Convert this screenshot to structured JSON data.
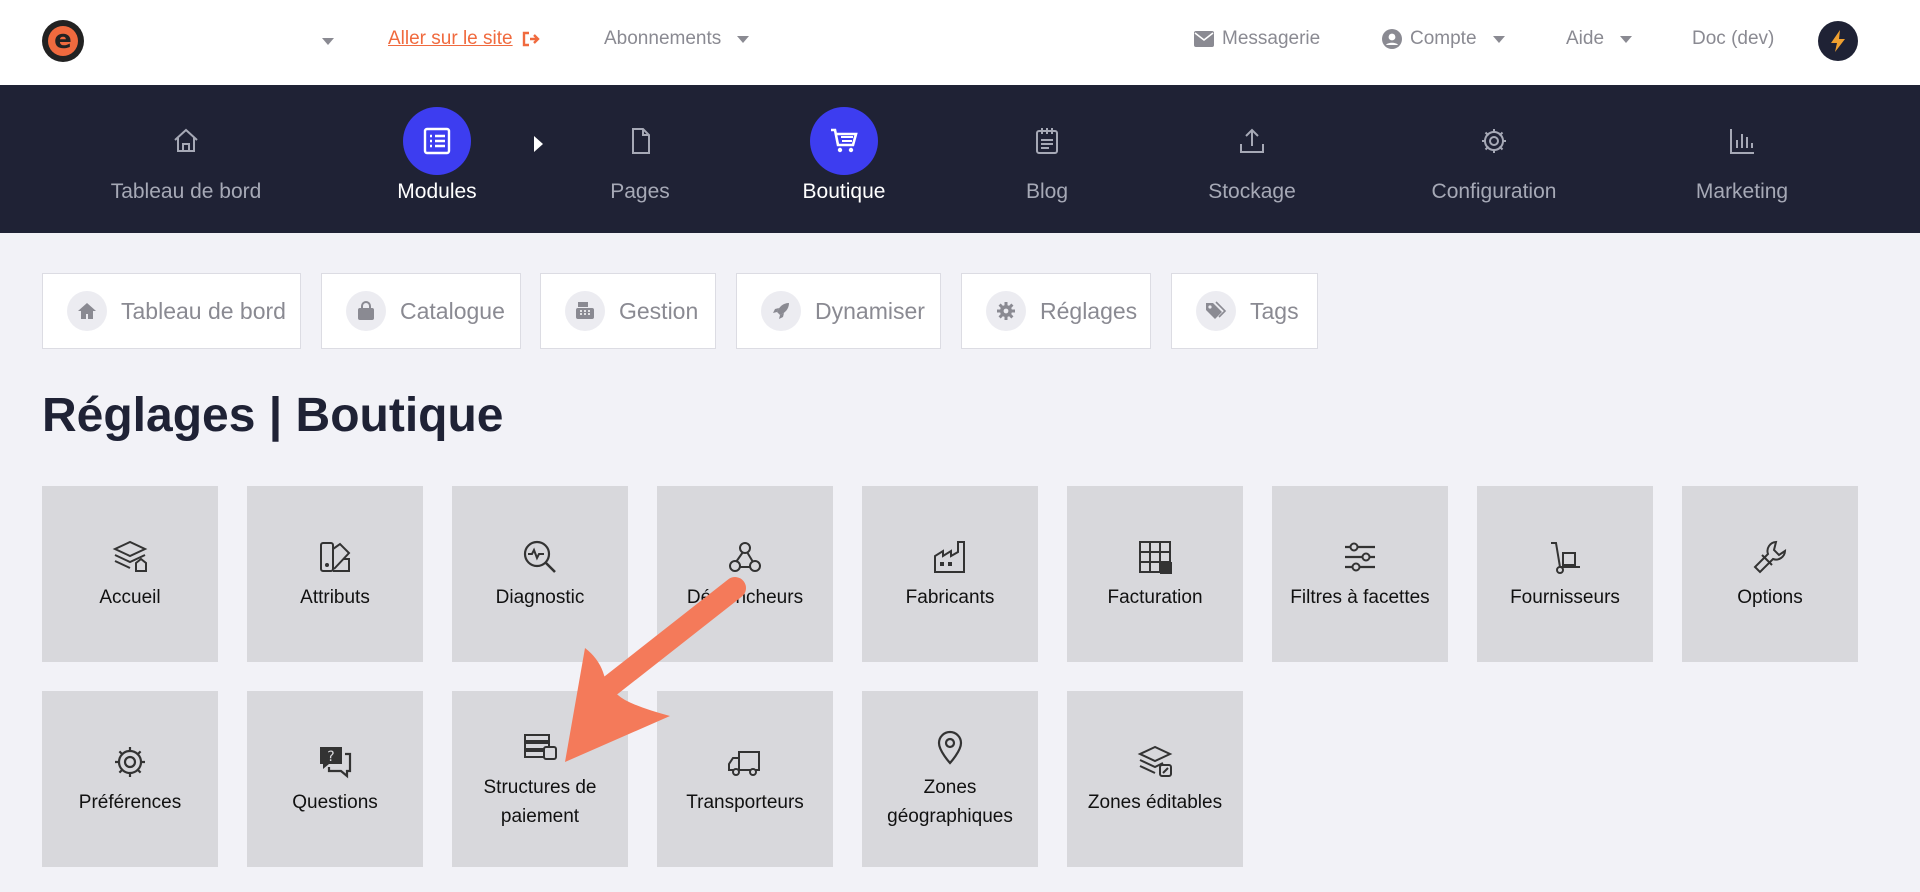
{
  "topbar": {
    "logo_letter": "e",
    "site_link": "Aller sur le site",
    "subscriptions": "Abonnements",
    "messages": "Messagerie",
    "account": "Compte",
    "help": "Aide",
    "doc": "Doc (dev)"
  },
  "nav": {
    "items": [
      {
        "label": "Tableau de bord",
        "icon": "home-icon",
        "active": false
      },
      {
        "label": "Modules",
        "icon": "list-icon",
        "active": true
      },
      {
        "label": "Pages",
        "icon": "file-icon",
        "active": false
      },
      {
        "label": "Boutique",
        "icon": "cart-icon",
        "active": true
      },
      {
        "label": "Blog",
        "icon": "notepad-icon",
        "active": false
      },
      {
        "label": "Stockage",
        "icon": "upload-icon",
        "active": false
      },
      {
        "label": "Configuration",
        "icon": "gear-icon",
        "active": false
      },
      {
        "label": "Marketing",
        "icon": "bar-chart-icon",
        "active": false
      }
    ]
  },
  "subtabs": [
    {
      "label": "Tableau de bord",
      "icon": "home-icon"
    },
    {
      "label": "Catalogue",
      "icon": "bag-icon"
    },
    {
      "label": "Gestion",
      "icon": "register-icon"
    },
    {
      "label": "Dynamiser",
      "icon": "rocket-icon"
    },
    {
      "label": "Réglages",
      "icon": "gear-icon"
    },
    {
      "label": "Tags",
      "icon": "tags-icon"
    }
  ],
  "page_title": "Réglages | Boutique",
  "tiles": [
    {
      "label": "Accueil",
      "icon": "layers-home-icon"
    },
    {
      "label": "Attributs",
      "icon": "swatch-icon"
    },
    {
      "label": "Diagnostic",
      "icon": "search-pulse-icon"
    },
    {
      "label": "Déclencheurs",
      "icon": "webhook-icon"
    },
    {
      "label": "Fabricants",
      "icon": "factory-icon"
    },
    {
      "label": "Facturation",
      "icon": "grid-invoice-icon"
    },
    {
      "label": "Filtres à facettes",
      "icon": "sliders-icon"
    },
    {
      "label": "Fournisseurs",
      "icon": "dolly-icon"
    },
    {
      "label": "Options",
      "icon": "wrench-icon"
    },
    {
      "label": "Préférences",
      "icon": "gear-icon"
    },
    {
      "label": "Questions",
      "icon": "question-chat-icon"
    },
    {
      "label": "Structures de paiement",
      "icon": "cash-stack-icon"
    },
    {
      "label": "Transporteurs",
      "icon": "truck-icon"
    },
    {
      "label": "Zones géographiques",
      "icon": "map-pin-icon"
    },
    {
      "label": "Zones éditables",
      "icon": "layers-edit-icon"
    }
  ],
  "colors": {
    "accent": "#3d3df0",
    "nav_bg": "#1f2235",
    "link": "#f06a3e",
    "annotation_arrow": "#f47a5a",
    "tile_bg": "#d8d8dc"
  }
}
